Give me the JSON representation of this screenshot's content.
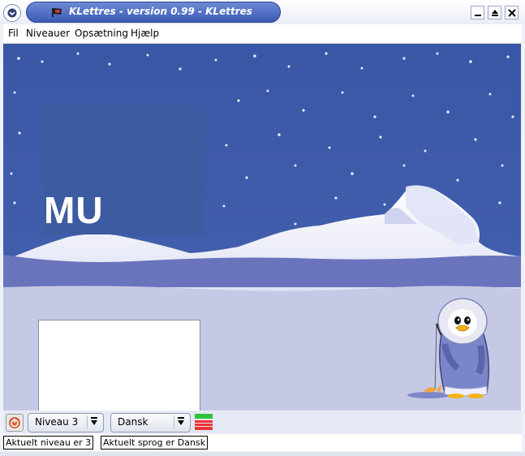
{
  "window": {
    "title": "KLettres - version 0.99 - KLettres",
    "buttons": [
      "minimize-icon",
      "maximize-icon",
      "close-icon"
    ]
  },
  "menubar": {
    "items": [
      {
        "label": "Fil"
      },
      {
        "label": "Niveauer"
      },
      {
        "label": "Opsætning"
      },
      {
        "label": "Hjælp"
      }
    ]
  },
  "game": {
    "letters": "MU",
    "input_value": ""
  },
  "toolbar": {
    "level_select": "Niveau 3",
    "language_select": "Dansk"
  },
  "statusbar": {
    "level_text": "Aktuelt niveau er 3",
    "language_text": "Aktuelt sprog er Dansk"
  },
  "colors": {
    "sky": "#3a59a8",
    "title_bar": "#4a69c0",
    "snow": "#c9cce8"
  }
}
